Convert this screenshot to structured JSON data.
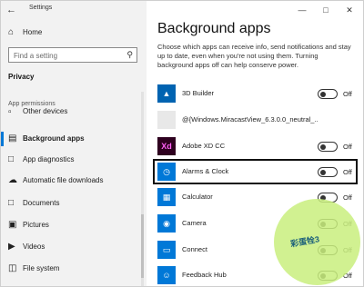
{
  "window": {
    "title": "Settings"
  },
  "sidebar": {
    "home_label": "Home",
    "search_placeholder": "Find a setting",
    "section_title": "Privacy",
    "group_label": "App permissions",
    "items": [
      {
        "label": "Other devices",
        "icon": "devices-icon"
      },
      {
        "label": "Background apps",
        "icon": "background-apps-icon",
        "active": true
      },
      {
        "label": "App diagnostics",
        "icon": "diagnostics-icon"
      },
      {
        "label": "Automatic file downloads",
        "icon": "cloud-icon"
      },
      {
        "label": "Documents",
        "icon": "document-icon"
      },
      {
        "label": "Pictures",
        "icon": "picture-icon"
      },
      {
        "label": "Videos",
        "icon": "video-icon"
      },
      {
        "label": "File system",
        "icon": "file-system-icon"
      }
    ]
  },
  "main": {
    "title": "Background apps",
    "description": "Choose which apps can receive info, send notifications and stay up to date, even when you're not using them. Turning background apps off can help conserve power.",
    "apps": [
      {
        "name": "3D Builder",
        "state": "Off",
        "icon_color": "#0063b1"
      },
      {
        "name": "@{Windows.MiracastView_6.3.0.0_neutral_...",
        "state": "Off",
        "icon_color": "#e8e8e8"
      },
      {
        "name": "Adobe XD CC",
        "state": "Off",
        "icon_color": "#2e001f",
        "icon_text": "Xd"
      },
      {
        "name": "Alarms & Clock",
        "state": "Off",
        "icon_color": "#0078d7"
      },
      {
        "name": "Calculator",
        "state": "Off",
        "icon_color": "#0078d7"
      },
      {
        "name": "Camera",
        "state": "Off",
        "icon_color": "#0078d7"
      },
      {
        "name": "Connect",
        "state": "Off",
        "icon_color": "#0078d7"
      },
      {
        "name": "Feedback Hub",
        "state": "Off",
        "icon_color": "#0078d7"
      }
    ]
  },
  "watermark": {
    "text": "彩蛋牷3"
  }
}
